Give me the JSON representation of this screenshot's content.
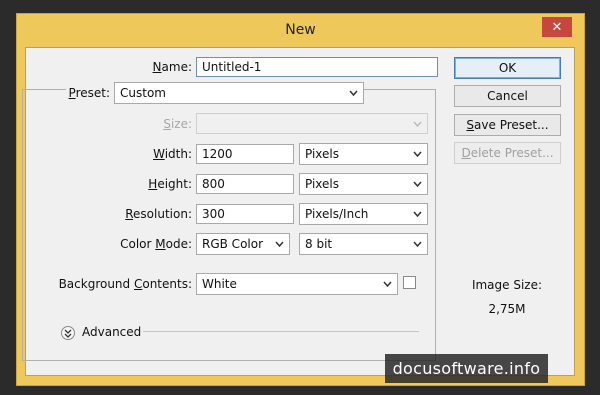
{
  "window": {
    "title": "New",
    "close_glyph": "✕",
    "accent": "#eec85a",
    "close_color": "#c6473d"
  },
  "form": {
    "name": {
      "label_u": "N",
      "label_rest": "ame:",
      "value": "Untitled-1"
    },
    "preset": {
      "label_u": "P",
      "label_rest": "reset:",
      "value": "Custom"
    },
    "size": {
      "label_u": "S",
      "label_rest": "ize:",
      "value": ""
    },
    "width": {
      "label_u": "W",
      "label_rest": "idth:",
      "value": "1200",
      "unit": "Pixels"
    },
    "height": {
      "label_u": "H",
      "label_rest": "eight:",
      "value": "800",
      "unit": "Pixels"
    },
    "resolution": {
      "label_u": "R",
      "label_rest": "esolution:",
      "value": "300",
      "unit": "Pixels/Inch"
    },
    "color_mode": {
      "label_pre": "Color ",
      "label_u": "M",
      "label_rest": "ode:",
      "value": "RGB Color",
      "bits": "8 bit"
    },
    "background": {
      "label_pre": "Background ",
      "label_u": "C",
      "label_rest": "ontents:",
      "value": "White"
    },
    "advanced": {
      "label": "Advanced"
    }
  },
  "buttons": {
    "ok": "OK",
    "cancel": "Cancel",
    "save_preset_u": "S",
    "save_preset_rest": "ave Preset...",
    "delete_preset_u": "D",
    "delete_preset_rest": "elete Preset..."
  },
  "image_size": {
    "label": "Image Size:",
    "value": "2,75M"
  },
  "watermark": "docusoftware.info"
}
